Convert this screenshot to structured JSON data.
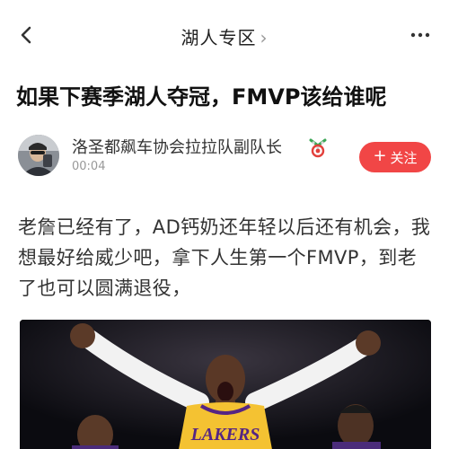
{
  "header": {
    "title": "湖人专区",
    "chevron": "›",
    "back_icon": "chevron-left-icon",
    "more_icon": "more-dots-icon"
  },
  "post": {
    "title": "如果下赛季湖人夺冠，FMVP该给谁呢",
    "author": {
      "name": "洛圣都飙车协会拉拉队副队长",
      "time": "00:04",
      "badge_icon": "italy-flag-badge-icon"
    },
    "follow_label": "关注",
    "follow_plus": "+",
    "body": "老詹已经有了，AD钙奶还年轻以后还有机会，我想最好给威少吧，拿下人生第一个FMVP，到老了也可以圆满退役，",
    "jersey_text": "LAKERS"
  },
  "colors": {
    "accent": "#f14646",
    "jersey_gold": "#f4c232",
    "jersey_purple": "#552583"
  }
}
